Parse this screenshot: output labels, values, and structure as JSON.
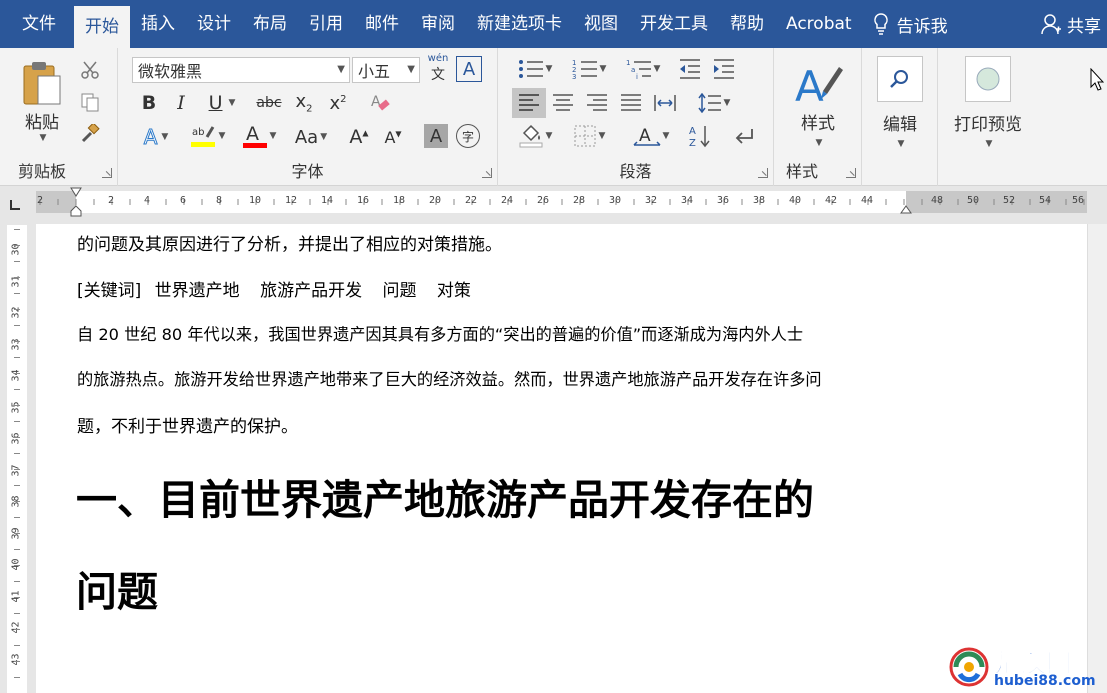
{
  "tabs": [
    "文件",
    "开始",
    "插入",
    "设计",
    "布局",
    "引用",
    "邮件",
    "审阅",
    "新建选项卡",
    "视图",
    "开发工具",
    "帮助",
    "Acrobat"
  ],
  "active_tab": "开始",
  "tell_me": "告诉我",
  "share": "共享",
  "ribbon": {
    "clipboard": {
      "paste": "粘贴",
      "label": "剪贴板"
    },
    "font": {
      "name": "微软雅黑",
      "size": "小五",
      "label": "字体"
    },
    "paragraph": {
      "label": "段落"
    },
    "styles": {
      "button": "样式",
      "label": "样式"
    },
    "editing": {
      "button": "编辑"
    },
    "print": {
      "button": "打印预览"
    }
  },
  "ruler": {
    "h_numbers": [
      "2",
      "2",
      "4",
      "6",
      "8",
      "10",
      "12",
      "14",
      "16",
      "18",
      "20",
      "22",
      "24",
      "26",
      "28",
      "30",
      "32",
      "34",
      "36",
      "38",
      "40",
      "42",
      "44",
      "48",
      "50",
      "52",
      "54",
      "56"
    ],
    "v_numbers": [
      "30",
      "31",
      "32",
      "33",
      "34",
      "35",
      "36",
      "37",
      "38",
      "39",
      "40",
      "41",
      "42",
      "43"
    ]
  },
  "document": {
    "line1": "的问题及其原因进行了分析，并提出了相应的对策措施。",
    "keywords_label": "[关键词]",
    "keywords": [
      "世界遗产地",
      "旅游产品开发",
      "问题",
      "对策"
    ],
    "para_line1": "自 20 世纪 80 年代以来，我国世界遗产因其具有多方面的“突出的普遍的价值”而逐渐成为海内外人士",
    "para_line2": "的旅游热点。旅游开发给世界遗产地带来了巨大的经济效益。然而，世界遗产地旅游产品开发存在许多问",
    "para_line3": "题，不利于世界遗产的保护。",
    "heading_line1": "一、目前世界遗产地旅游产品开发存在的",
    "heading_line2": "问题"
  },
  "watermark": {
    "name": "楚汉网",
    "url": "hubei88.com"
  },
  "colors": {
    "accent": "#2b579a",
    "highlight": "#ffff00",
    "font_color": "#ff0000"
  }
}
